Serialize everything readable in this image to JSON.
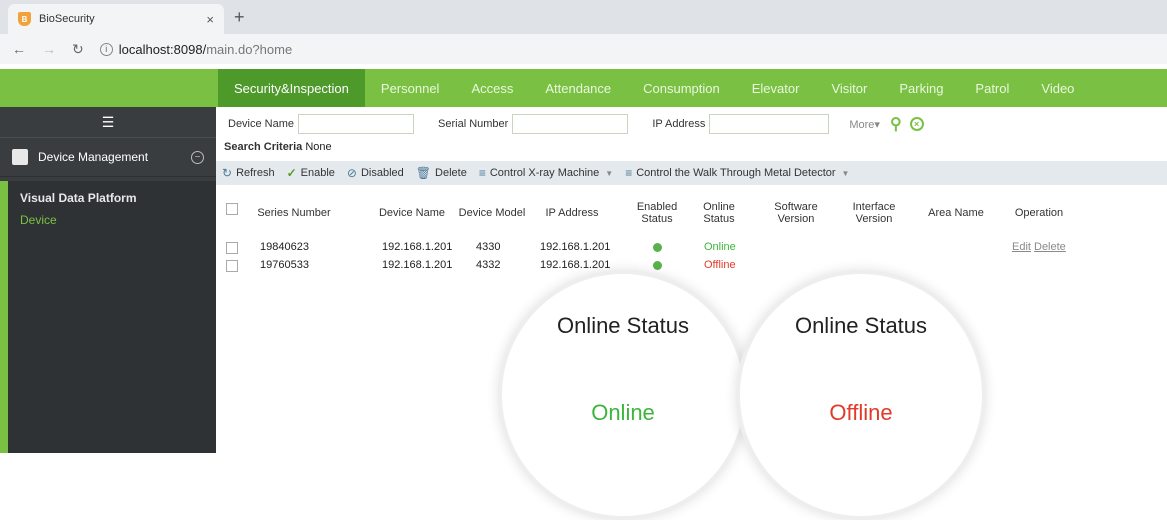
{
  "browser": {
    "tab_title": "BioSecurity",
    "tab_close": "×",
    "new_tab": "+",
    "url_host": "localhost:8098/",
    "url_path": "main.do?home"
  },
  "nav": {
    "tabs": [
      "Security&Inspection",
      "Personnel",
      "Access",
      "Attendance",
      "Consumption",
      "Elevator",
      "Visitor",
      "Parking",
      "Patrol",
      "Video"
    ],
    "active_index": 0
  },
  "sidebar": {
    "group_label": "Device Management",
    "items": [
      "Visual Data Platform",
      "Device"
    ]
  },
  "search": {
    "device_name_label": "Device Name",
    "serial_number_label": "Serial Number",
    "ip_address_label": "IP Address",
    "device_name_value": "",
    "serial_number_value": "",
    "ip_address_value": "",
    "more_label": "More▾"
  },
  "criteria": {
    "label": "Search Criteria",
    "value": "None"
  },
  "toolbar": {
    "refresh": "Refresh",
    "enable": "Enable",
    "disabled": "Disabled",
    "delete": "Delete",
    "xray": "Control X-ray Machine",
    "metal": "Control the Walk Through Metal Detector"
  },
  "table": {
    "headers": [
      "Series Number",
      "Device Name",
      "Device Model",
      "IP Address",
      "Enabled Status",
      "Online Status",
      "Software Version",
      "Interface Version",
      "Area Name",
      "Operation"
    ],
    "rows": [
      {
        "series": "19840623",
        "name": "192.168.1.201",
        "model": "4330",
        "ip": "192.168.1.201",
        "online": "Online",
        "ops": [
          "Edit",
          "Delete"
        ]
      },
      {
        "series": "19760533",
        "name": "192.168.1.201",
        "model": "4332",
        "ip": "192.168.1.201",
        "online": "Offline",
        "ops": []
      }
    ]
  },
  "callouts": [
    {
      "title": "Online Status",
      "value": "Online"
    },
    {
      "title": "Online Status",
      "value": "Offline"
    }
  ],
  "colors": {
    "brand_green": "#7ac143",
    "active_tab": "#4d9a2a",
    "online": "#3db53d",
    "offline": "#e23a2a"
  }
}
